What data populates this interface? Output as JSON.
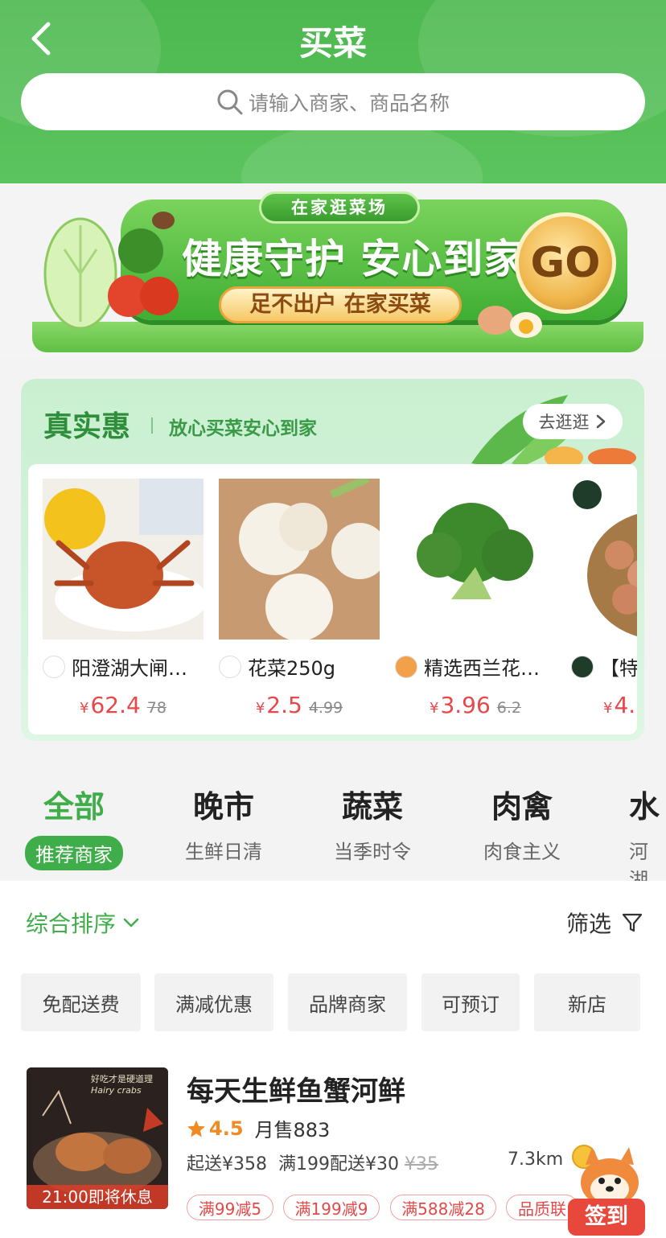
{
  "header": {
    "title": "买菜",
    "search_placeholder": "请输入商家、商品名称"
  },
  "banner": {
    "tag": "在家逛菜场",
    "title": "健康守护 安心到家",
    "subtitle": "足不出户 在家买菜",
    "go": "GO"
  },
  "deals": {
    "title": "真实惠",
    "subtitle": "放心买菜安心到家",
    "more": "去逛逛",
    "products": [
      {
        "name": "阳澄湖大闸…",
        "currency": "¥",
        "price": "62.4",
        "old_price": "78"
      },
      {
        "name": "花菜250g",
        "currency": "¥",
        "price": "2.5",
        "old_price": "4.99"
      },
      {
        "name": "精选西兰花…",
        "currency": "¥",
        "price": "3.96",
        "old_price": "6.2"
      },
      {
        "name": "【特",
        "currency": "¥",
        "price": "4.",
        "old_price": ""
      }
    ]
  },
  "categories": [
    {
      "title": "全部",
      "sub": "推荐商家",
      "active": true
    },
    {
      "title": "晚市",
      "sub": "生鲜日清"
    },
    {
      "title": "蔬菜",
      "sub": "当季时令"
    },
    {
      "title": "肉禽",
      "sub": "肉食主义"
    },
    {
      "title": "水",
      "sub": "河湖"
    }
  ],
  "sort": {
    "label": "综合排序",
    "filter": "筛选"
  },
  "chips": [
    "免配送费",
    "满减优惠",
    "品牌商家",
    "可预订",
    "新店"
  ],
  "shop": {
    "image_text_line1": "好吃才是硬道理",
    "image_text_line2": "Hairy crabs",
    "rest_notice": "21:00即将休息",
    "name": "每天生鲜鱼蟹河鲜",
    "rating": "4.5",
    "monthly_sales": "月售883",
    "delivery_min": "起送¥358",
    "delivery_fee": "满199配送¥30",
    "delivery_old": "¥35",
    "distance": "7.3km",
    "promos": [
      "满99减5",
      "满199减9",
      "满588减28",
      "品质联"
    ]
  },
  "signin": {
    "label": "签到"
  },
  "colors": {
    "brand_green": "#3fae4a",
    "price_red": "#e8474b",
    "rating_orange": "#f08a24"
  }
}
